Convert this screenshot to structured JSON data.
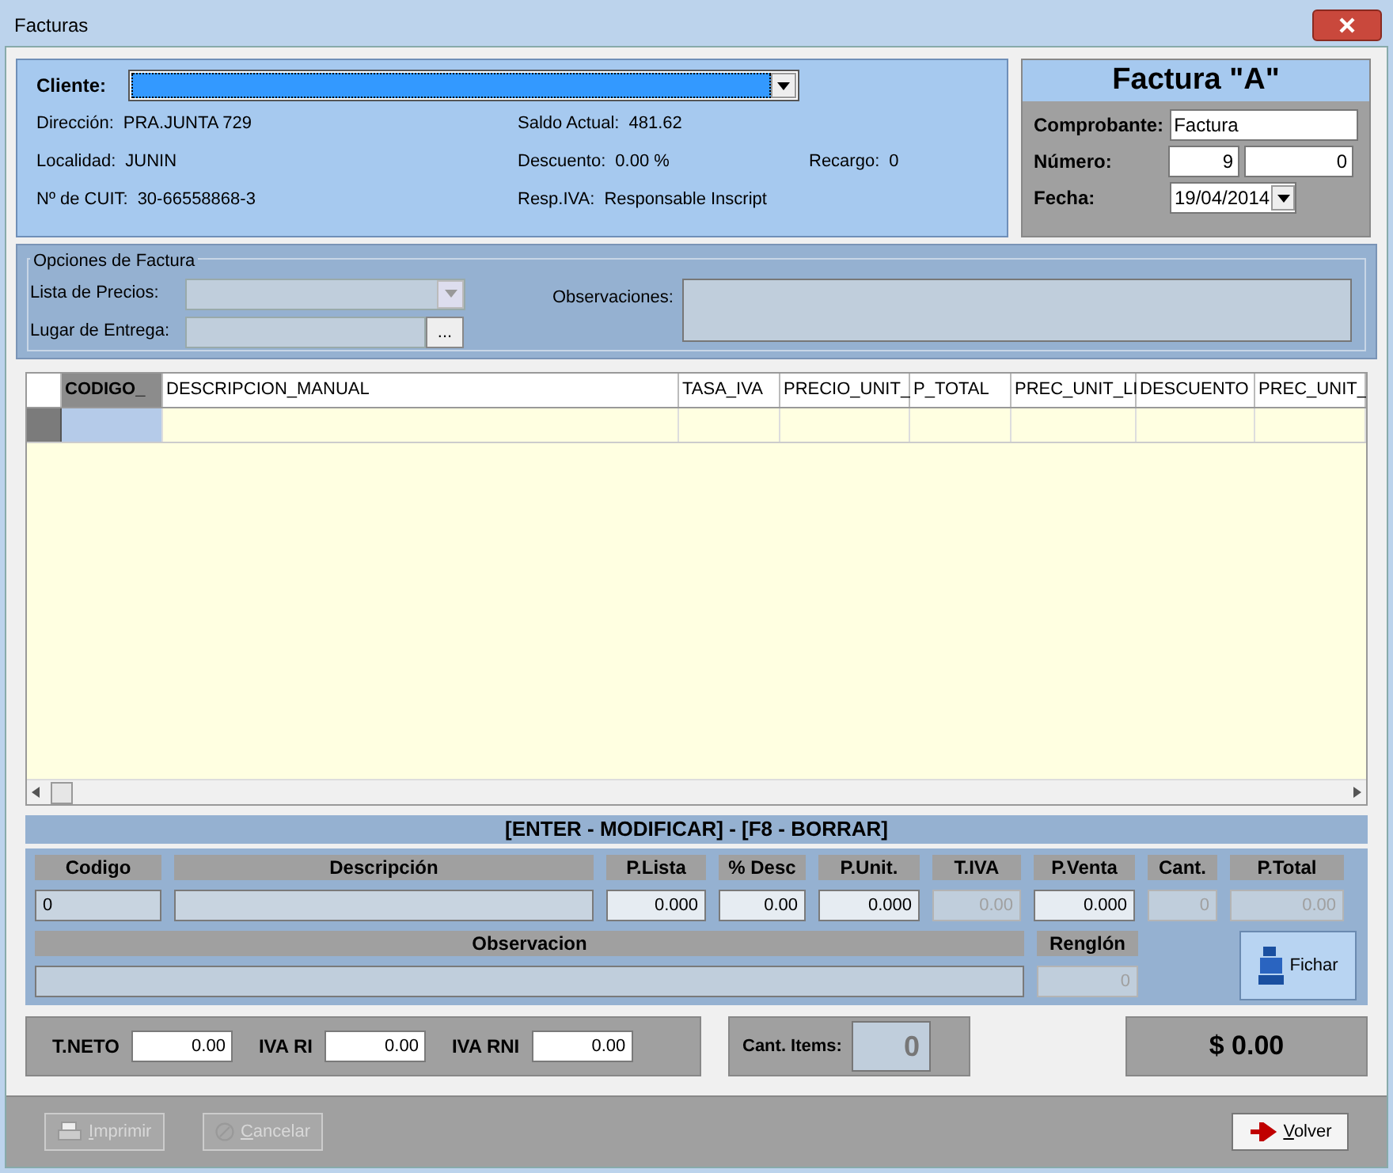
{
  "window": {
    "title": "Facturas"
  },
  "cliente": {
    "label": "Cliente:",
    "selected": true
  },
  "info_rows": [
    [
      {
        "label": "Dirección:",
        "value": "PRA.JUNTA 729"
      },
      {
        "label": "Saldo Actual:",
        "value": "481.62"
      }
    ],
    [
      {
        "label": "Localidad:",
        "value": "JUNIN"
      },
      {
        "label": "Descuento:",
        "value": "0.00 %"
      },
      {
        "label": "Recargo:",
        "value": "0"
      }
    ],
    [
      {
        "label": "Nº de CUIT:",
        "value": "30-66558868-3"
      },
      {
        "label": "Resp.IVA:",
        "value": "Responsable Inscript"
      }
    ]
  ],
  "factura": {
    "title": "Factura \"A\"",
    "comprobante": {
      "label": "Comprobante:",
      "value": "Factura"
    },
    "numero": {
      "label": "Número:",
      "values": [
        "9",
        "0"
      ]
    },
    "fecha": {
      "label": "Fecha:",
      "value": "19/04/2014"
    }
  },
  "opciones": {
    "title": "Opciones de Factura",
    "lista_precios": {
      "label": "Lista de Precios:",
      "disabled": true
    },
    "lugar_entrega": {
      "label": "Lugar de Entrega:",
      "button": "..."
    },
    "observaciones": {
      "label": "Observaciones:"
    }
  },
  "grid": {
    "columns": [
      {
        "label": "CODIGO_",
        "selected": true
      },
      {
        "label": "DESCRIPCION_MANUAL",
        "selected": false
      },
      {
        "label": "TASA_IVA",
        "selected": false
      },
      {
        "label": "PRECIO_UNIT_",
        "selected": false
      },
      {
        "label": "P_TOTAL",
        "selected": false
      },
      {
        "label": "PREC_UNIT_LI",
        "selected": false
      },
      {
        "label": "DESCUENTO",
        "selected": false
      },
      {
        "label": "PREC_UNIT_",
        "selected": false
      }
    ]
  },
  "hint": "[ENTER - MODIFICAR] - [F8 - BORRAR]",
  "detail": [
    {
      "label": "Codigo",
      "value": "0",
      "kind": "text",
      "disabled": false
    },
    {
      "label": "Descripción",
      "kind": "text",
      "disabled": false
    },
    {
      "label": "P.Lista",
      "value": "0.000",
      "kind": "number",
      "disabled": false
    },
    {
      "label": "% Desc",
      "value": "0.00",
      "kind": "number",
      "disabled": false
    },
    {
      "label": "P.Unit.",
      "value": "0.000",
      "kind": "number",
      "disabled": false
    },
    {
      "label": "T.IVA",
      "value": "0.00",
      "kind": "number",
      "disabled": true
    },
    {
      "label": "P.Venta",
      "value": "0.000",
      "kind": "number",
      "disabled": false
    },
    {
      "label": "Cant.",
      "value": "0",
      "kind": "number",
      "disabled": true
    },
    {
      "label": "P.Total",
      "value": "0.00",
      "kind": "number",
      "disabled": true
    }
  ],
  "observacion": {
    "label": "Observacion"
  },
  "renglon": {
    "label": "Renglón",
    "value": "0",
    "disabled": true
  },
  "fichar": "Fichar",
  "totals": [
    {
      "label": "T.NETO",
      "value": "0.00"
    },
    {
      "label": "IVA RI",
      "value": "0.00"
    },
    {
      "label": "IVA RNI",
      "value": "0.00"
    }
  ],
  "cant_items": {
    "label": "Cant. Items:",
    "value": "0"
  },
  "total": "$ 0.00",
  "buttons": [
    {
      "label": "Imprimir",
      "kind": "print",
      "disabled": true
    },
    {
      "label": "Cancelar",
      "kind": "cancel",
      "disabled": true
    },
    {
      "label": "Volver",
      "kind": "back",
      "disabled": false
    }
  ]
}
